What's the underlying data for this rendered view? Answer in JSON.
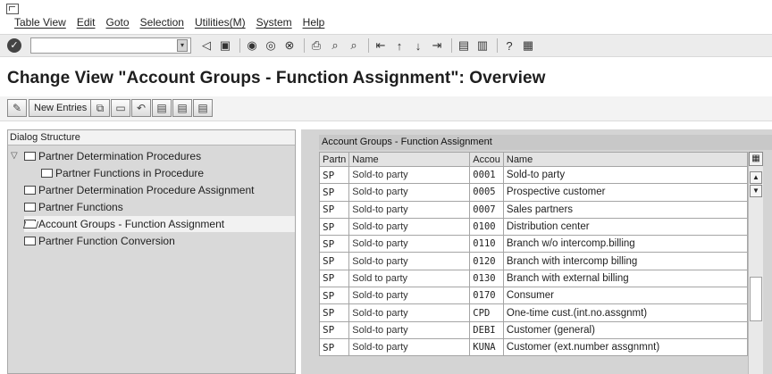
{
  "menubar": {
    "items": [
      "Table View",
      "Edit",
      "Goto",
      "Selection",
      "Utilities(M)",
      "System",
      "Help"
    ]
  },
  "toolbar": {
    "command_value": "",
    "icons": [
      "back-icon",
      "save-icon",
      "prev-icon",
      "exit-icon",
      "cancel-icon",
      "print-icon",
      "find-icon",
      "find-next-icon",
      "first-page-icon",
      "prev-page-icon",
      "next-page-icon",
      "last-page-icon",
      "new-session-icon",
      "shortcut-icon",
      "help-icon",
      "layout-icon"
    ]
  },
  "page": {
    "title": "Change View \"Account Groups - Function Assignment\": Overview"
  },
  "apptoolbar": {
    "new_entries_label": "New Entries"
  },
  "dialog_structure": {
    "header": "Dialog Structure",
    "items": [
      {
        "label": "Partner Determination Procedures",
        "level": 0,
        "expanded": true
      },
      {
        "label": "Partner Functions in Procedure",
        "level": 1
      },
      {
        "label": "Partner Determination Procedure Assignment",
        "level": 0
      },
      {
        "label": "Partner Functions",
        "level": 0
      },
      {
        "label": "Account Groups - Function Assignment",
        "level": 0,
        "selected": true
      },
      {
        "label": "Partner Function Conversion",
        "level": 0
      }
    ]
  },
  "table": {
    "title": "Account Groups - Function Assignment",
    "columns": [
      "Partn",
      "Name",
      "Accou",
      "Name"
    ],
    "rows": [
      [
        "SP",
        "Sold-to party",
        "0001",
        "Sold-to party"
      ],
      [
        "SP",
        "Sold-to party",
        "0005",
        "Prospective customer"
      ],
      [
        "SP",
        "Sold-to party",
        "0007",
        "Sales partners"
      ],
      [
        "SP",
        "Sold-to party",
        "0100",
        "Distribution center"
      ],
      [
        "SP",
        "Sold-to party",
        "0110",
        "Branch w/o intercomp.billing"
      ],
      [
        "SP",
        "Sold-to party",
        "0120",
        "Branch with intercomp billing"
      ],
      [
        "SP",
        "Sold to party",
        "0130",
        "Branch with external billing"
      ],
      [
        "SP",
        "Sold-to party",
        "0170",
        "Consumer"
      ],
      [
        "SP",
        "Sold-to party",
        "CPD",
        "One-time cust.(int.no.assgnmt)"
      ],
      [
        "SP",
        "Sold-to party",
        "DEBI",
        "Customer (general)"
      ],
      [
        "SP",
        "Sold-to party",
        "KUNA",
        "Customer (ext.number assgnmnt)"
      ]
    ]
  }
}
